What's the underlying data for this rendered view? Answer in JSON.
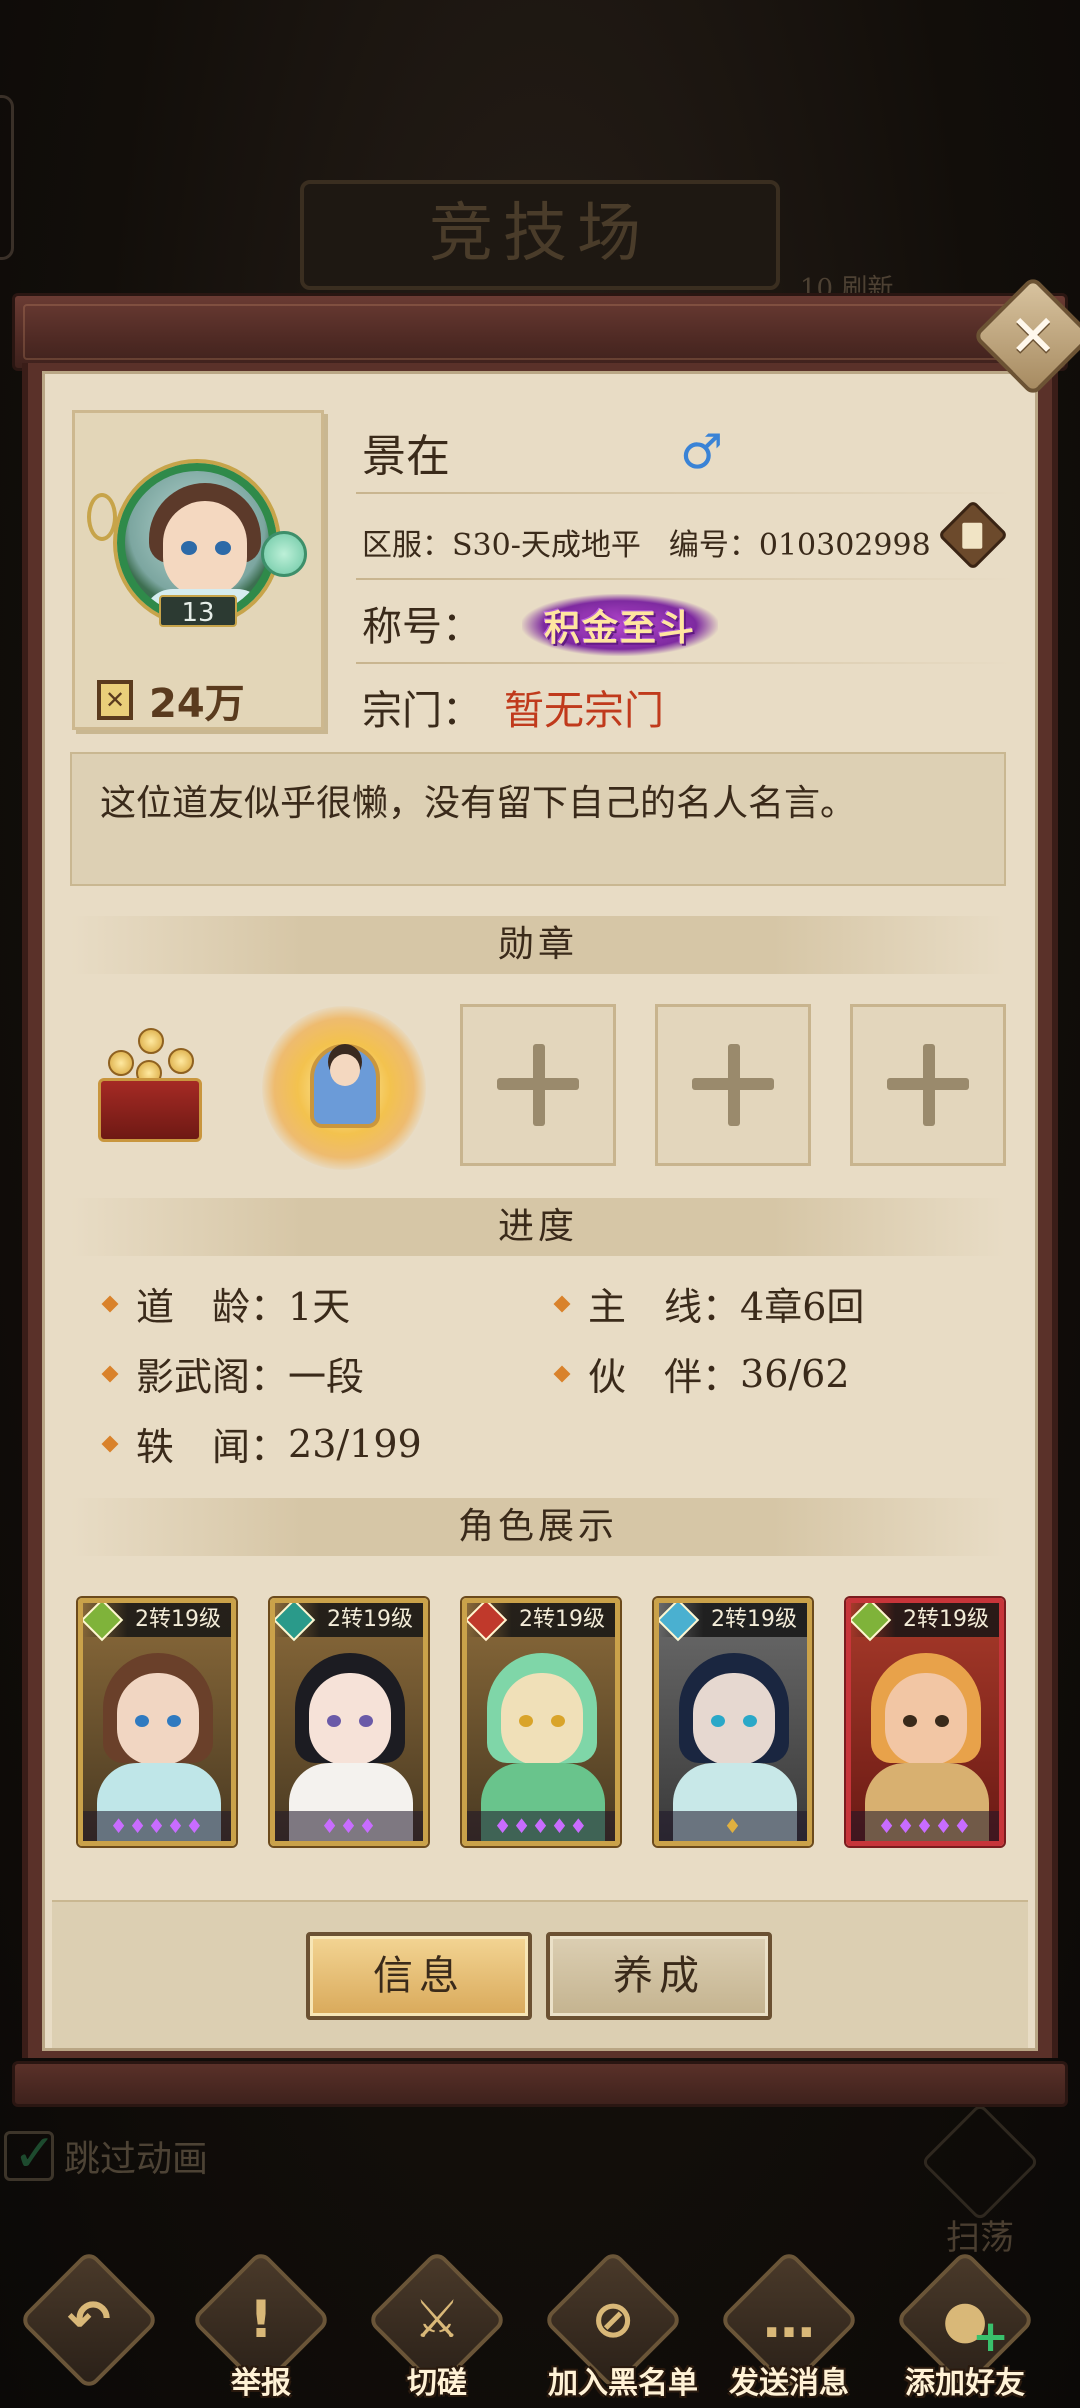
{
  "background": {
    "arena_title": "竞技场",
    "refresh_text": "10 刷新",
    "skip_animation": "跳过动画",
    "sweep_label": "扫荡"
  },
  "profile": {
    "name": "景在",
    "gender_icon": "male-symbol-icon",
    "avatar_level": "13",
    "power": "24万",
    "server_label": "区服：",
    "server_value": "S30-天成地平",
    "id_label": "编号：",
    "id_value": "010302998",
    "title_label": "称号：",
    "title_badge": "积金至斗",
    "sect_label": "宗门：",
    "sect_value": "暂无宗门",
    "motto": "这位道友似乎很懒，没有留下自己的名人名言。"
  },
  "medals": {
    "heading": "勋章",
    "empty_slots": 3
  },
  "progress": {
    "heading": "进度",
    "items": [
      {
        "label": "道　龄：",
        "value": "1天"
      },
      {
        "label": "主　线：",
        "value": "4章6回"
      },
      {
        "label": "影武阁：",
        "value": "一段"
      },
      {
        "label": "伙　伴：",
        "value": "36/62"
      },
      {
        "label": "轶　闻：",
        "value": "23/199"
      }
    ]
  },
  "characters": {
    "heading": "角色展示",
    "cards": [
      {
        "level": "2转19级",
        "stars": "♦♦♦♦♦",
        "type_color": "#7fb33a",
        "frame": "gold"
      },
      {
        "level": "2转19级",
        "stars": "♦♦♦",
        "type_color": "#2a9a8a",
        "frame": "gold"
      },
      {
        "level": "2转19级",
        "stars": "♦♦♦♦♦",
        "type_color": "#c0392b",
        "frame": "gold"
      },
      {
        "level": "2转19级",
        "stars": "♦",
        "type_color": "#4ab0d0",
        "frame": "gold"
      },
      {
        "level": "2转19级",
        "stars": "♦♦♦♦♦",
        "type_color": "#7fb33a",
        "frame": "red"
      }
    ]
  },
  "buttons": {
    "info": "信息",
    "develop": "养成"
  },
  "nav": [
    {
      "label": "",
      "icon": "back-arrow-icon"
    },
    {
      "label": "举报",
      "icon": "warning-icon"
    },
    {
      "label": "切磋",
      "icon": "crossed-swords-icon"
    },
    {
      "label": "加入黑名单",
      "icon": "block-user-icon"
    },
    {
      "label": "发送消息",
      "icon": "chat-bubble-icon"
    },
    {
      "label": "添加好友",
      "icon": "add-friend-icon"
    }
  ],
  "colors": {
    "sect_text": "#c03a1c",
    "gender_male": "#3a83d6",
    "panel_bg": "#e8dcc5",
    "modal_frame": "#5a3129"
  }
}
